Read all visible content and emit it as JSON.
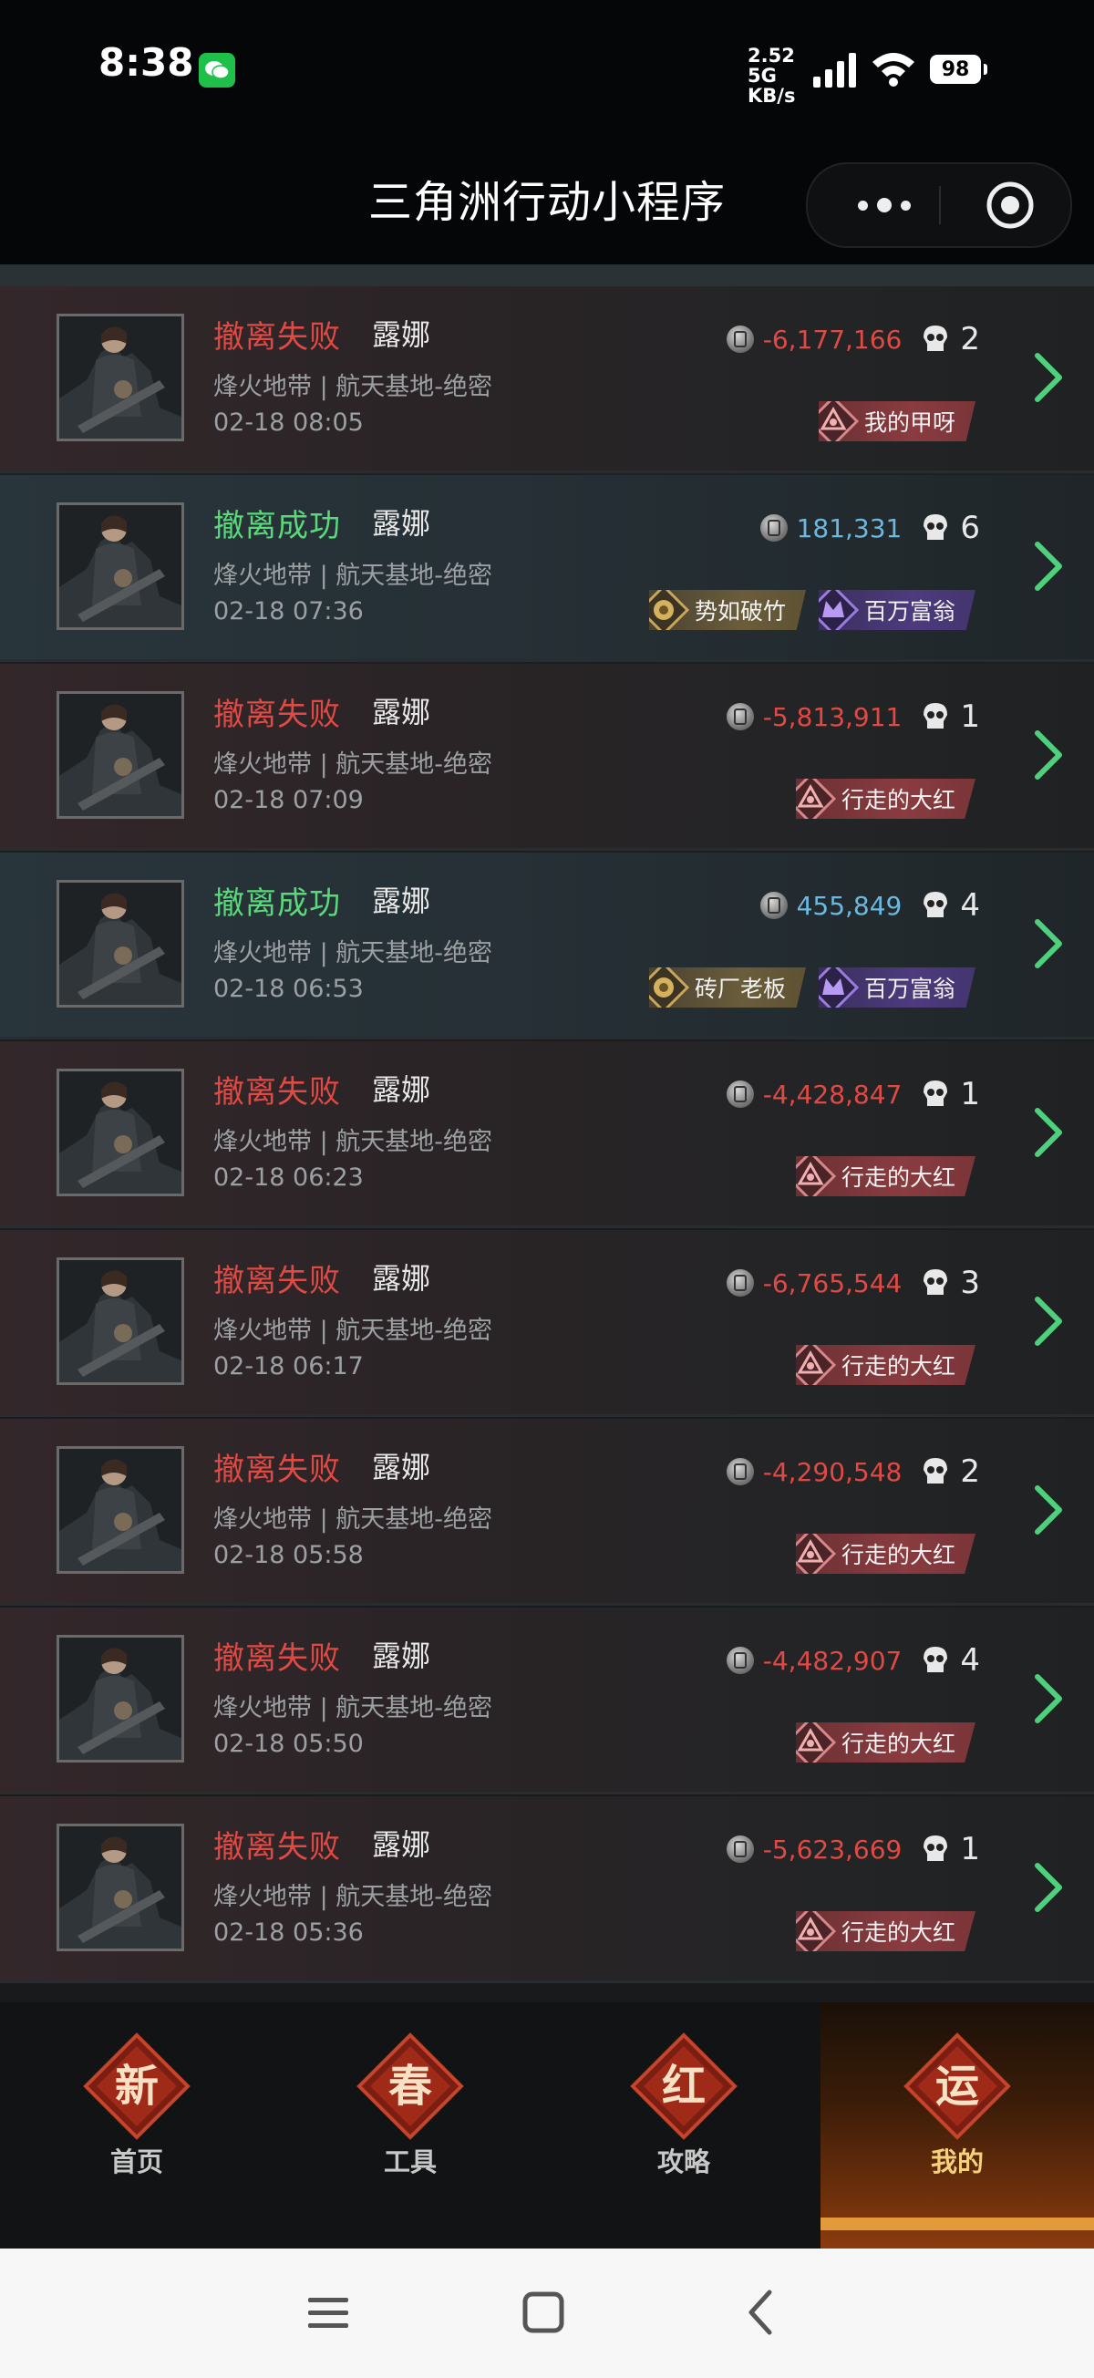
{
  "status_bar": {
    "time": "8:38",
    "net_speed": "2.52",
    "net_unit": "KB/s",
    "net_type": "5G",
    "battery": "98"
  },
  "header": {
    "title": "三角洲行动小程序"
  },
  "records": [
    {
      "result": "撤离失败",
      "type": "fail",
      "name": "露娜",
      "map": "烽火地带 | 航天基地-绝密",
      "time": "02-18 08:05",
      "money": "-6,177,166",
      "kills": "2",
      "badges": [
        {
          "label": "我的甲呀",
          "style": "red",
          "icon": "triangle-emblem-icon"
        }
      ]
    },
    {
      "result": "撤离成功",
      "type": "success",
      "name": "露娜",
      "map": "烽火地带 | 航天基地-绝密",
      "time": "02-18 07:36",
      "money": "181,331",
      "kills": "6",
      "badges": [
        {
          "label": "势如破竹",
          "style": "gold",
          "icon": "gold-medal-icon"
        },
        {
          "label": "百万富翁",
          "style": "purple",
          "icon": "purple-crest-icon"
        }
      ]
    },
    {
      "result": "撤离失败",
      "type": "fail",
      "name": "露娜",
      "map": "烽火地带 | 航天基地-绝密",
      "time": "02-18 07:09",
      "money": "-5,813,911",
      "kills": "1",
      "badges": [
        {
          "label": "行走的大红",
          "style": "red",
          "icon": "triangle-emblem-icon"
        }
      ]
    },
    {
      "result": "撤离成功",
      "type": "success",
      "name": "露娜",
      "map": "烽火地带 | 航天基地-绝密",
      "time": "02-18 06:53",
      "money": "455,849",
      "kills": "4",
      "badges": [
        {
          "label": "砖厂老板",
          "style": "gold",
          "icon": "gold-medal-icon"
        },
        {
          "label": "百万富翁",
          "style": "purple",
          "icon": "purple-crest-icon"
        }
      ]
    },
    {
      "result": "撤离失败",
      "type": "fail",
      "name": "露娜",
      "map": "烽火地带 | 航天基地-绝密",
      "time": "02-18 06:23",
      "money": "-4,428,847",
      "kills": "1",
      "badges": [
        {
          "label": "行走的大红",
          "style": "red",
          "icon": "triangle-emblem-icon"
        }
      ]
    },
    {
      "result": "撤离失败",
      "type": "fail",
      "name": "露娜",
      "map": "烽火地带 | 航天基地-绝密",
      "time": "02-18 06:17",
      "money": "-6,765,544",
      "kills": "3",
      "badges": [
        {
          "label": "行走的大红",
          "style": "red",
          "icon": "triangle-emblem-icon"
        }
      ]
    },
    {
      "result": "撤离失败",
      "type": "fail",
      "name": "露娜",
      "map": "烽火地带 | 航天基地-绝密",
      "time": "02-18 05:58",
      "money": "-4,290,548",
      "kills": "2",
      "badges": [
        {
          "label": "行走的大红",
          "style": "red",
          "icon": "triangle-emblem-icon"
        }
      ]
    },
    {
      "result": "撤离失败",
      "type": "fail",
      "name": "露娜",
      "map": "烽火地带 | 航天基地-绝密",
      "time": "02-18 05:50",
      "money": "-4,482,907",
      "kills": "4",
      "badges": [
        {
          "label": "行走的大红",
          "style": "red",
          "icon": "triangle-emblem-icon"
        }
      ]
    },
    {
      "result": "撤离失败",
      "type": "fail",
      "name": "露娜",
      "map": "烽火地带 | 航天基地-绝密",
      "time": "02-18 05:36",
      "money": "-5,623,669",
      "kills": "1",
      "badges": [
        {
          "label": "行走的大红",
          "style": "red",
          "icon": "triangle-emblem-icon"
        }
      ]
    }
  ],
  "tabs": [
    {
      "label": "首页",
      "glyph": "新",
      "active": false
    },
    {
      "label": "工具",
      "glyph": "春",
      "active": false
    },
    {
      "label": "攻略",
      "glyph": "红",
      "active": false
    },
    {
      "label": "我的",
      "glyph": "运",
      "active": true
    }
  ],
  "colors": {
    "fail": "#e04a44",
    "success": "#59d97a",
    "positive_money": "#6bb8e0",
    "chevron": "#4fd07c",
    "active_tab": "#f6d07a"
  }
}
